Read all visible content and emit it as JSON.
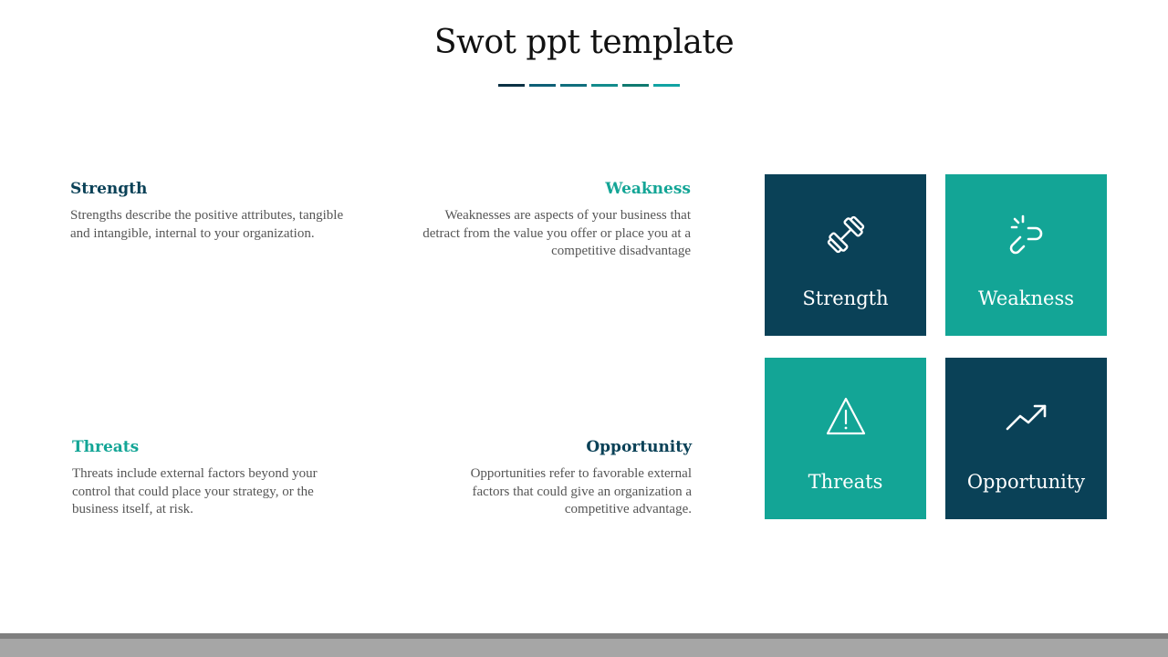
{
  "title": "Swot ppt template",
  "colors": {
    "dark": "#0a4157",
    "teal": "#13a596",
    "rule": [
      "#0b3143",
      "#0e5f76",
      "#106e7d",
      "#128b8c",
      "#0f7a70",
      "#11a3a3"
    ],
    "body_text": "#555555",
    "footer_dark": "#7f7f7f",
    "footer_light": "#a6a6a6"
  },
  "sections": {
    "strength": {
      "heading": "Strength",
      "text": "Strengths describe the positive attributes, tangible and intangible, internal to your organization."
    },
    "weakness": {
      "heading": "Weakness",
      "text": "Weaknesses are aspects of your business that detract from the value you offer or place you at a competitive disadvantage"
    },
    "threats": {
      "heading": "Threats",
      "text": "Threats include external factors beyond your control that could place your strategy, or the business itself, at risk."
    },
    "opportunity": {
      "heading": "Opportunity",
      "text": "Opportunities refer to favorable external factors that could give an organization a competitive advantage."
    }
  },
  "tiles": [
    {
      "label": "Strength",
      "icon": "dumbbell-icon",
      "color": "#0a4157"
    },
    {
      "label": "Weakness",
      "icon": "broken-link-icon",
      "color": "#13a596"
    },
    {
      "label": "Threats",
      "icon": "warning-icon",
      "color": "#13a596"
    },
    {
      "label": "Opportunity",
      "icon": "trend-up-icon",
      "color": "#0a4157"
    }
  ]
}
